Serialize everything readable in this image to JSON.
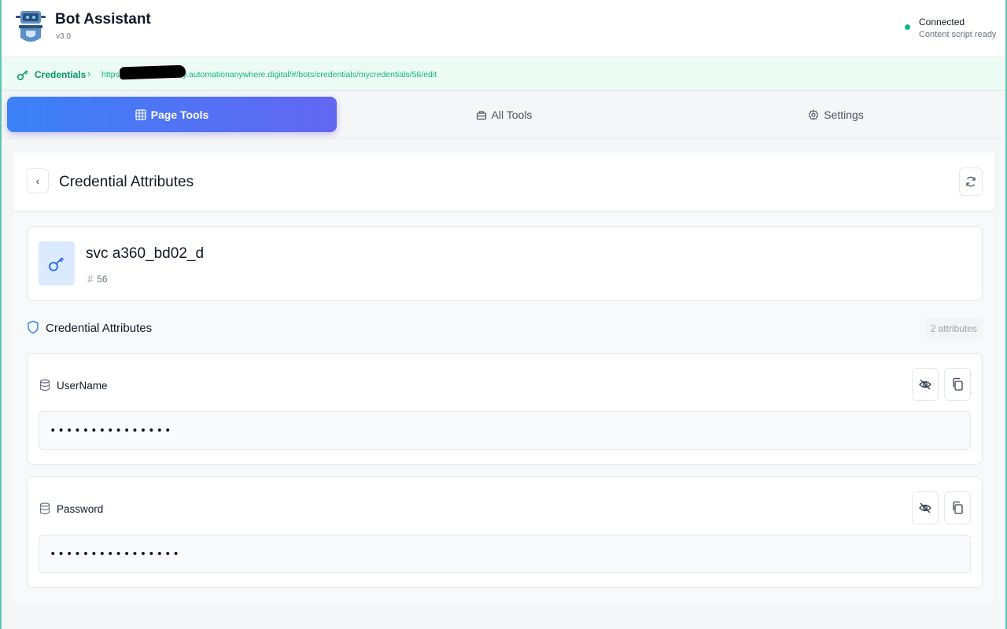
{
  "app": {
    "title": "Bot Assistant",
    "version": "v3.0",
    "status": "Connected",
    "status_detail": "Content script ready",
    "status_color": "#10b981"
  },
  "breadcrumb": {
    "label": "Credentials",
    "url_prefix": "https:",
    "url_suffix": "ny.automationanywhere.digital/#/bots/credentials/mycredentials/56/edit"
  },
  "tabs": [
    {
      "label": "Page Tools",
      "icon": "grid-icon",
      "active": true
    },
    {
      "label": "All Tools",
      "icon": "toolbox-icon",
      "active": false
    },
    {
      "label": "Settings",
      "icon": "gear-icon",
      "active": false
    }
  ],
  "panel": {
    "title": "Credential Attributes"
  },
  "credential": {
    "name": "svc a360_bd02_d",
    "id_symbol": "#",
    "id": "56"
  },
  "attributes_section": {
    "title": "Credential Attributes",
    "count": "2 attributes"
  },
  "attributes": [
    {
      "label": "UserName",
      "value": "•••••••••••••••"
    },
    {
      "label": "Password",
      "value": "••••••••••••••••"
    }
  ],
  "colors": {
    "accent_start": "#3b82f6",
    "accent_end": "#6366f1",
    "breadcrumb_green": "#059669"
  }
}
